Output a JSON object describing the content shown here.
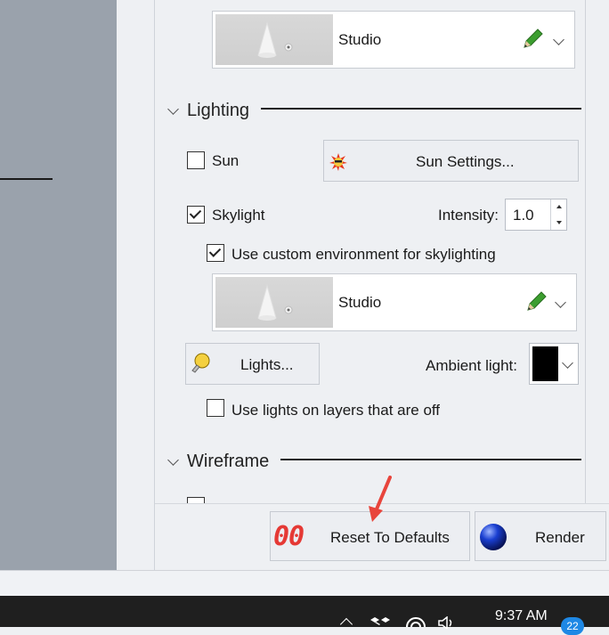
{
  "environment_top": {
    "name": "Studio"
  },
  "sections": {
    "lighting": "Lighting",
    "wireframe": "Wireframe"
  },
  "lighting": {
    "sun": {
      "label": "Sun",
      "checked": false
    },
    "sun_settings_button": "Sun Settings...",
    "skylight": {
      "label": "Skylight",
      "checked": true
    },
    "intensity": {
      "label": "Intensity:",
      "value": "1.0"
    },
    "custom_env": {
      "label": "Use custom environment for skylighting",
      "checked": true
    },
    "environment": {
      "name": "Studio"
    },
    "lights_button": "Lights...",
    "ambient_light": {
      "label": "Ambient light:",
      "color": "#000000"
    },
    "lights_off_layers": {
      "label": "Use lights on layers that are off",
      "checked": false
    }
  },
  "footer": {
    "reset_button": "Reset To Defaults",
    "reset_icon_text": "00",
    "render_button": "Render"
  },
  "taskbar": {
    "time": "9:37 AM",
    "notification_count": "22"
  },
  "colors": {
    "accent_red": "#e53935",
    "render_blue": "#1a3fd1",
    "bulb_yellow": "#f4d03f"
  }
}
